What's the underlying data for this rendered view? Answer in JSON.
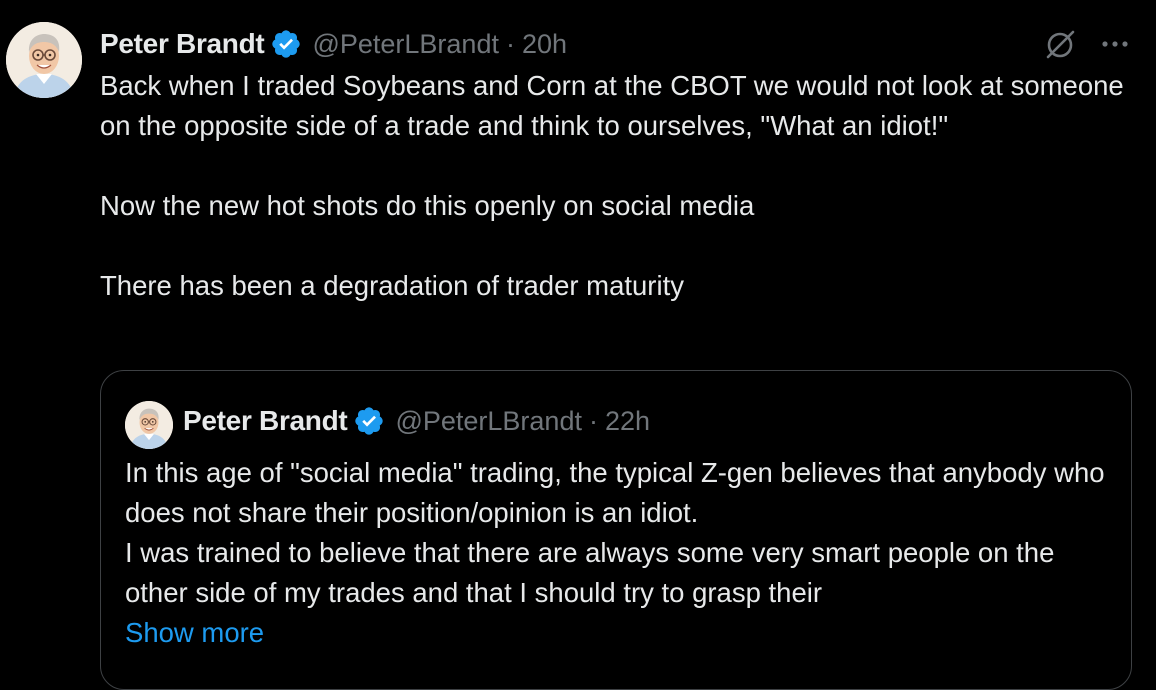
{
  "tweet": {
    "author": {
      "name": "Peter Brandt",
      "handle": "@PeterLBrandt",
      "verified": true
    },
    "separator": "·",
    "time": "20h",
    "text_paragraphs": [
      "Back when I traded Soybeans and Corn at the CBOT we would not look at someone on the opposite side of a trade and think to ourselves, \"What an idiot!\"",
      "Now the new hot shots do this openly on social media",
      "There has been a degradation of trader maturity"
    ],
    "icons": {
      "grok": "grok-icon",
      "more": "more-icon",
      "verified": "verified-badge-icon"
    }
  },
  "quoted_tweet": {
    "author": {
      "name": "Peter Brandt",
      "handle": "@PeterLBrandt",
      "verified": true
    },
    "separator": "·",
    "time": "22h",
    "text_lines": [
      "In this age of \"social media\" trading, the typical Z-gen believes that anybody who does not share their position/opinion is an idiot.",
      "I was trained to believe that there are always some very smart people on the other side of my trades and that I should try to grasp their"
    ],
    "show_more_label": "Show more"
  },
  "colors": {
    "background": "#000000",
    "text_primary": "#e7e9ea",
    "text_secondary": "#71767b",
    "accent": "#1d9bf0",
    "border": "#3e4144"
  }
}
